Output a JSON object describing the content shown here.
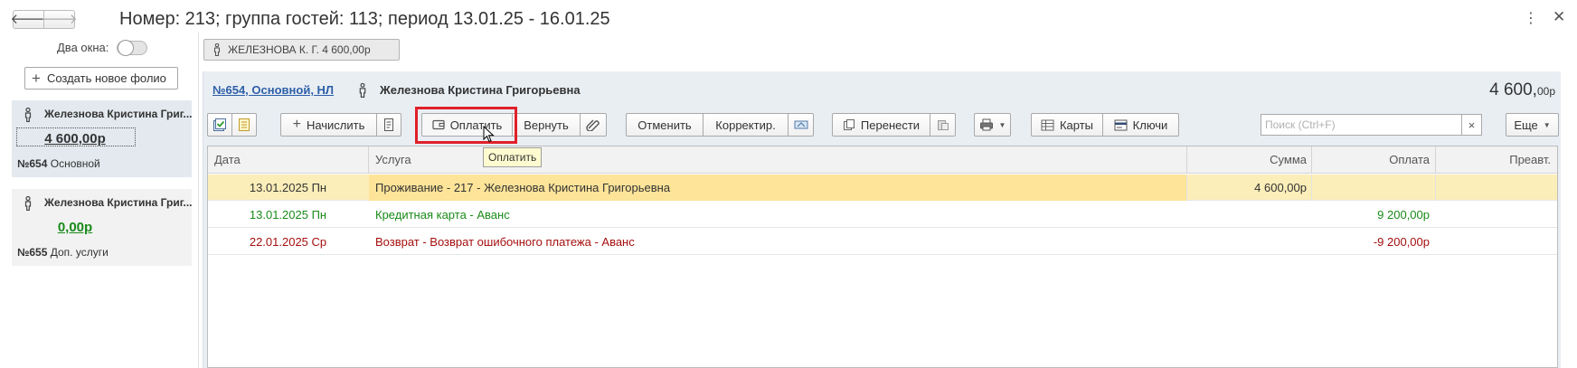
{
  "header": {
    "back_glyph": "🡐",
    "forward_glyph": "🡒",
    "title": "Номер: 213; группа гостей: 113; период 13.01.25 - 16.01.25",
    "kebab_glyph": "⋮",
    "close_glyph": "✕"
  },
  "sidebar": {
    "two_windows_label": "Два окна:",
    "two_windows_on": false,
    "new_folio_label": "Создать новое фолио",
    "folios": [
      {
        "name": "Железнова Кристина Григ...",
        "amount": "4 600,00р",
        "number": "№654",
        "type": "Основной"
      },
      {
        "name": "Железнова Кристина Григ...",
        "amount": "0,00р",
        "number": "№655",
        "type": "Доп. услуги"
      }
    ]
  },
  "guest_tab": {
    "label": "ЖЕЛЕЗНОВА К. Г. 4 600,00р"
  },
  "panel": {
    "folio_link": "№654, Основной, НЛ",
    "guest_name": "Железнова Кристина Григорьевна",
    "total_main": "4 600,",
    "total_cents": "00р"
  },
  "toolbar": {
    "charge_label": "Начислить",
    "pay_label": "Оплатить",
    "return_label": "Вернуть",
    "cancel_label": "Отменить",
    "correct_label": "Корректир.",
    "transfer_label": "Перенести",
    "cards_label": "Карты",
    "keys_label": "Ключи",
    "more_label": "Еще",
    "search_placeholder": "Поиск (Ctrl+F)",
    "clear_glyph": "×",
    "tooltip": "Оплатить"
  },
  "table": {
    "columns": {
      "date": "Дата",
      "service": "Услуга",
      "sum": "Сумма",
      "payment": "Оплата",
      "prepay": "Преавт."
    },
    "rows": [
      {
        "date": "13.01.2025 Пн",
        "service": "Проживание - 217 - Железнова Кристина Григорьевна",
        "sum": "4 600,00р",
        "payment": "",
        "prepay": "",
        "kind": "charge"
      },
      {
        "date": "13.01.2025 Пн",
        "service": "Кредитная карта - Аванс",
        "sum": "",
        "payment": "9 200,00р",
        "prepay": "",
        "kind": "payment"
      },
      {
        "date": "22.01.2025 Ср",
        "service": "Возврат - Возврат ошибочного платежа - Аванс",
        "sum": "",
        "payment": "-9 200,00р",
        "prepay": "",
        "kind": "refund"
      }
    ]
  },
  "colors": {
    "accent_link": "#2d5ea7",
    "payment_green": "#1a8a1a",
    "refund_red": "#a50f0f",
    "selected_row": "#fbeeb9",
    "highlight_red": "#e0202a"
  }
}
